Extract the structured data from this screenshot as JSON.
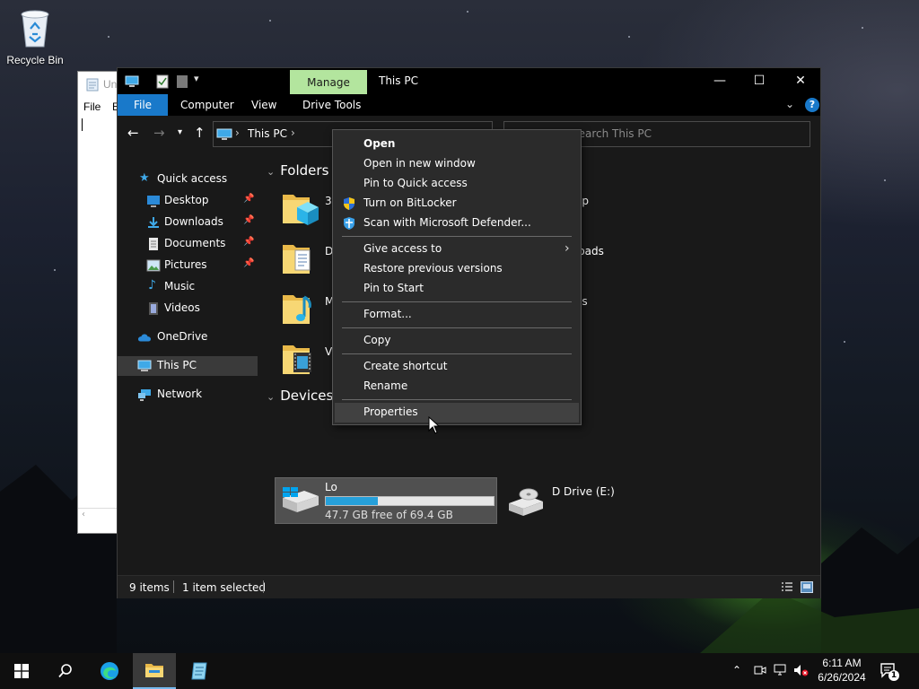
{
  "desktop": {
    "recycle_bin_label": "Recycle Bin"
  },
  "notepad": {
    "title_fragment": "Un",
    "menu_file": "File",
    "menu_edit_fragment": "E"
  },
  "explorer": {
    "title": "This PC",
    "manage_tab": "Manage",
    "ribbon_tabs": {
      "file": "File",
      "computer": "Computer",
      "view": "View",
      "drive_tools": "Drive Tools"
    },
    "help_label": "?",
    "address": {
      "location": "This PC"
    },
    "search": {
      "placeholder": "Search This PC"
    },
    "sidebar": {
      "quick_access": "Quick access",
      "desktop": "Desktop",
      "downloads": "Downloads",
      "documents": "Documents",
      "pictures": "Pictures",
      "music": "Music",
      "videos": "Videos",
      "onedrive": "OneDrive",
      "this_pc": "This PC",
      "network": "Network"
    },
    "content": {
      "folders_header": "Folders (",
      "devices_header": "Devices a",
      "folder_labels": {
        "objects3d": "3D",
        "documents": "D",
        "music": "M",
        "videos": "Vi",
        "desktop": "op",
        "downloads": "loads",
        "pictures": "es"
      },
      "drive_c": {
        "label_fragment": "Lo",
        "free_text": "47.7 GB free of 69.4 GB",
        "used_fraction": 0.31
      },
      "drive_e_label_fragment": "D Drive (E:)"
    },
    "status": {
      "items": "9 items",
      "selected": "1 item selected"
    }
  },
  "context_menu": {
    "open": "Open",
    "open_new_window": "Open in new window",
    "pin_quick_access": "Pin to Quick access",
    "bitlocker": "Turn on BitLocker",
    "defender": "Scan with Microsoft Defender...",
    "give_access": "Give access to",
    "restore_versions": "Restore previous versions",
    "pin_start": "Pin to Start",
    "format": "Format...",
    "copy": "Copy",
    "create_shortcut": "Create shortcut",
    "rename": "Rename",
    "properties": "Properties"
  },
  "taskbar": {
    "time": "6:11 AM",
    "date": "6/26/2024",
    "notification_count": "1"
  },
  "colors": {
    "accent_blue": "#1979ca",
    "manage_green": "#b3e59e",
    "drive_bar": "#26a0da"
  }
}
